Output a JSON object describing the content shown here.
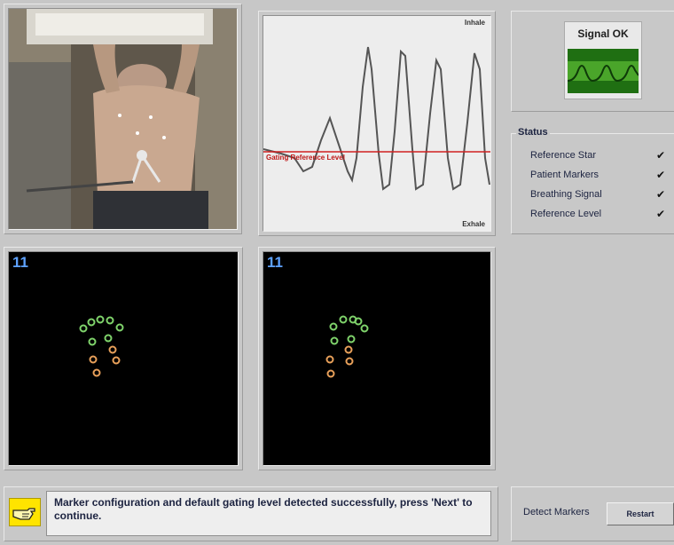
{
  "graph": {
    "inhale_label": "Inhale",
    "exhale_label": "Exhale",
    "reference_label": "Gating Reference Level",
    "reference_color": "#d02020"
  },
  "camera": {
    "left_number": "11",
    "right_number": "11",
    "marker_green": "#7fd36b",
    "marker_orange": "#e8a05a"
  },
  "signal": {
    "title": "Signal OK",
    "accent": "#2e8a1a"
  },
  "status": {
    "title": "Status",
    "items": [
      {
        "label": "Reference Star",
        "check": "✔"
      },
      {
        "label": "Patient Markers",
        "check": "✔"
      },
      {
        "label": "Breathing Signal",
        "check": "✔"
      },
      {
        "label": "Reference Level",
        "check": "✔"
      }
    ]
  },
  "message": {
    "text": "Marker configuration and default gating level detected successfully, press 'Next' to continue.",
    "icon": "pointing-hand-icon"
  },
  "actions": {
    "detect_label": "Detect Markers",
    "restart_label": "Restart"
  }
}
